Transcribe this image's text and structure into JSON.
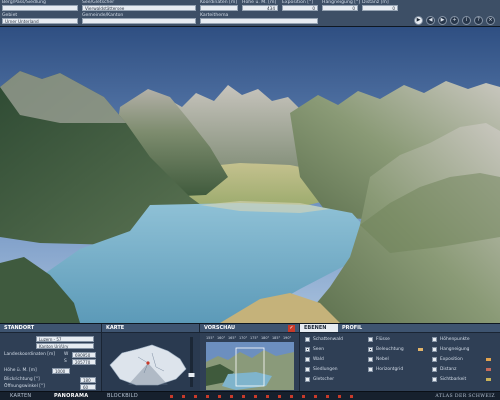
{
  "topbar": {
    "fields": [
      {
        "label": "Berg/Pass/Siedlung",
        "value": ""
      },
      {
        "label": "See/Gletscher",
        "value": "Vierwaldstättersee"
      },
      {
        "label": "Koordinaten [m]",
        "value": "Höhe ü. M. [m]"
      },
      {
        "label": "Höhe ü. M. [m]",
        "value": "434"
      },
      {
        "label": "Exposition [°]",
        "value": "0"
      },
      {
        "label": "Hangneigung [°]",
        "value": "0"
      },
      {
        "label": "Distanz [m]",
        "value": "0"
      },
      {
        "label": "Gebiet",
        "value": "Urner Unterland"
      },
      {
        "label": "Gemeinde/Kanton",
        "value": ""
      },
      {
        "label": "Karteithema",
        "value": ""
      }
    ],
    "buttons": [
      {
        "icon": "play-icon",
        "glyph": "▶"
      },
      {
        "icon": "back-icon",
        "glyph": "◀"
      },
      {
        "icon": "forward-icon",
        "glyph": "▶"
      },
      {
        "icon": "zoom-icon",
        "glyph": "+"
      },
      {
        "icon": "info-icon",
        "glyph": "i"
      },
      {
        "icon": "help-icon",
        "glyph": "?"
      },
      {
        "icon": "close-icon",
        "glyph": "×"
      }
    ]
  },
  "standort": {
    "title": "STANDORT",
    "select_value": "Luzern - 57",
    "select2_value": "Kanton Uri/Ury",
    "coord_label": "Landeskoordinaten [m]",
    "coord_w_label": "W",
    "coord_w_value": "690950",
    "coord_s_label": "S",
    "coord_s_value": "205770",
    "hoehe_label": "Höhe ü. M. [m]",
    "hoehe_value": "1000",
    "blick_label": "Blickrichtung [°]",
    "blick_value": "180",
    "winkel_label": "Öffnungswinkel [°]",
    "winkel_value": "60"
  },
  "karte": {
    "title": "KARTE"
  },
  "vorschau": {
    "title": "VORSCHAU",
    "scale": [
      "155°",
      "160°",
      "165°",
      "170°",
      "175°",
      "180°",
      "185°",
      "190°",
      "195°"
    ]
  },
  "ebenen": {
    "tabs": [
      "EBENEN",
      "PROFIL"
    ],
    "active_tab": 0,
    "items": [
      {
        "label": "Schattenwald",
        "checked": false,
        "color": ""
      },
      {
        "label": "Seen",
        "checked": true,
        "color": ""
      },
      {
        "label": "Wald",
        "checked": false,
        "color": ""
      },
      {
        "label": "Siedlungen",
        "checked": false,
        "color": ""
      },
      {
        "label": "Gletscher",
        "checked": false,
        "color": ""
      },
      {
        "label": "Flüsse",
        "checked": false,
        "color": ""
      },
      {
        "label": "Beleuchtung",
        "checked": true,
        "color": "#e2b46a"
      },
      {
        "label": "Nebel",
        "checked": false,
        "color": ""
      },
      {
        "label": "Horizontgrid",
        "checked": false,
        "color": ""
      },
      {
        "label": "Höhenpunkte",
        "checked": false,
        "color": ""
      },
      {
        "label": "Hangneigung",
        "checked": false,
        "color": ""
      },
      {
        "label": "Exposition",
        "checked": false,
        "color": "#e3a44f"
      },
      {
        "label": "Distanz",
        "checked": false,
        "color": "#c56b5a"
      },
      {
        "label": "Sichtbarkeit",
        "checked": false,
        "color": "#c9b25a"
      }
    ]
  },
  "nav": {
    "items": [
      "KARTEN",
      "PANORAMA",
      "BLOCKBILD"
    ],
    "active": 1,
    "brand": "ATLAS DER SCHWEIZ"
  },
  "colors": {
    "sky": "#3a5c8e",
    "lake": "#6aa6c4",
    "accent": "#c83a2a"
  }
}
